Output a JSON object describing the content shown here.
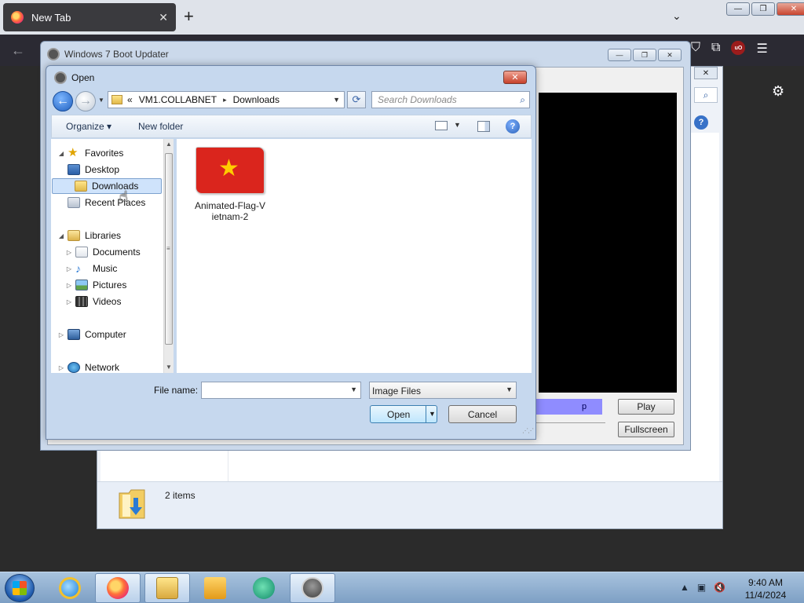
{
  "browser": {
    "tab_title": "New Tab",
    "tab_close": "✕",
    "new_tab": "+",
    "tab_list": "⌄",
    "back": "←"
  },
  "window_controls": {
    "minimize": "—",
    "restore": "❐",
    "close": "✕"
  },
  "explorer_bg": {
    "items_count": "2 items"
  },
  "updater": {
    "title": "Windows 7 Boot Updater",
    "progress_text": "p",
    "play_label": "Play",
    "fullscreen_label": "Fullscreen"
  },
  "dialog": {
    "title": "Open",
    "close": "✕",
    "address": {
      "chevrons": "«",
      "crumb1": "VM1.COLLABNET",
      "separator": "▸",
      "crumb2": "Downloads"
    },
    "search_placeholder": "Search Downloads",
    "toolbar": {
      "organize": "Organize ▾",
      "new_folder": "New folder",
      "help": "?"
    },
    "nav": {
      "favorites": "Favorites",
      "desktop": "Desktop",
      "downloads": "Downloads",
      "recent_places": "Recent Places",
      "libraries": "Libraries",
      "documents": "Documents",
      "music": "Music",
      "pictures": "Pictures",
      "videos": "Videos",
      "computer": "Computer",
      "network": "Network"
    },
    "files": [
      {
        "name": "Animated-Flag-Vietnam-2"
      }
    ],
    "file_name_label": "File name:",
    "file_name_value": "",
    "filter_value": "Image Files",
    "open_label": "Open",
    "cancel_label": "Cancel"
  },
  "taskbar": {
    "time": "9:40 AM",
    "date": "11/4/2024"
  }
}
